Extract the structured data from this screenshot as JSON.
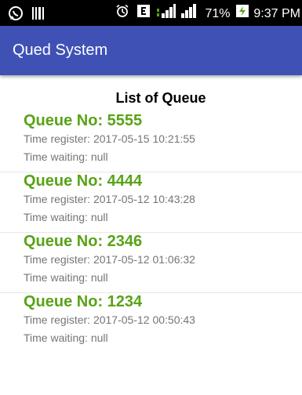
{
  "status_bar": {
    "battery": "71%",
    "time": "9:37 PM"
  },
  "app_bar": {
    "title": "Qued System"
  },
  "list": {
    "heading": "List of Queue",
    "items": [
      {
        "queue_label": "Queue No: 5555",
        "time_register": "Time register: 2017-05-15 10:21:55",
        "time_waiting": "Time waiting: null"
      },
      {
        "queue_label": "Queue No: 4444",
        "time_register": "Time register: 2017-05-12 10:43:28",
        "time_waiting": "Time waiting: null"
      },
      {
        "queue_label": "Queue No: 2346",
        "time_register": "Time register: 2017-05-12 01:06:32",
        "time_waiting": "Time waiting: null"
      },
      {
        "queue_label": "Queue No: 1234",
        "time_register": "Time register: 2017-05-12 00:50:43",
        "time_waiting": "Time waiting: null"
      }
    ]
  },
  "colors": {
    "app_bar": "#3f51b5",
    "queue_title": "#58a316",
    "secondary_text": "#757575",
    "status_bar": "#000000"
  }
}
